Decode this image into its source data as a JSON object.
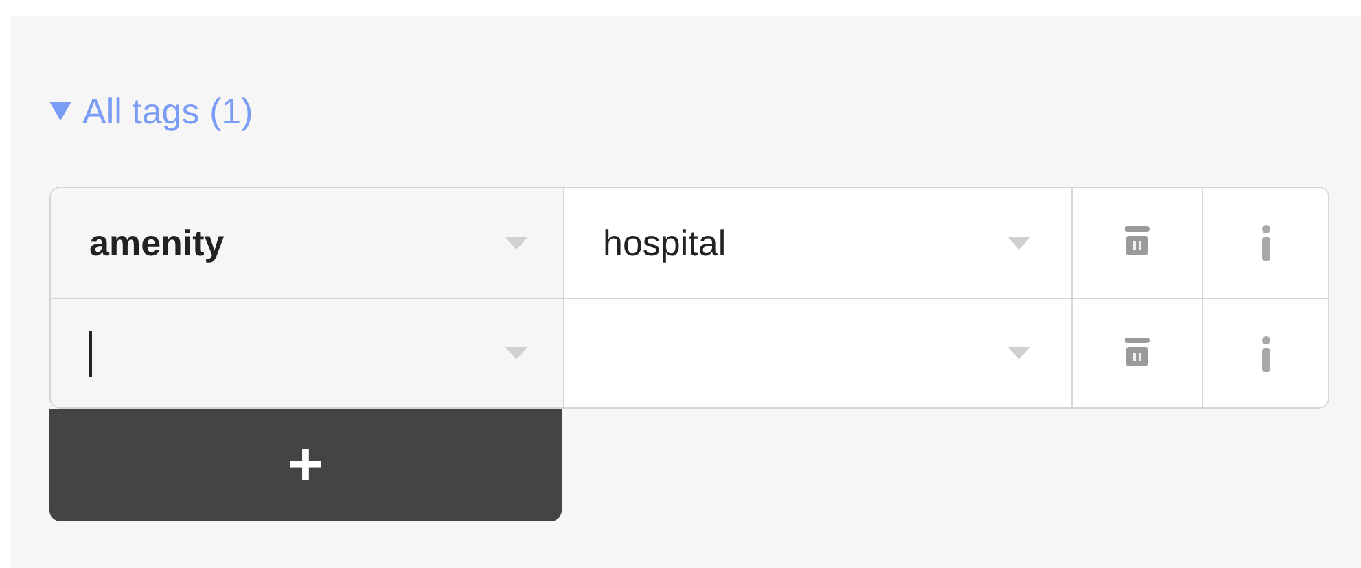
{
  "section": {
    "title": "All tags (1)",
    "expanded": true
  },
  "tags": [
    {
      "key": "amenity",
      "value": "hospital",
      "key_focused": false
    },
    {
      "key_focused": true
    }
  ],
  "add_button": "+"
}
